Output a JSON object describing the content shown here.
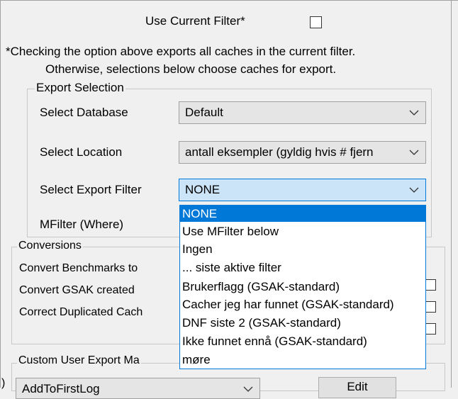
{
  "use_current_filter": {
    "label": "Use Current Filter*",
    "checked": false
  },
  "note": {
    "line1": "*Checking the option above exports all caches in the current filter.",
    "line2": "Otherwise, selections below choose caches for export."
  },
  "export_selection": {
    "legend": "Export Selection",
    "database_label": "Select Database",
    "database_value": "Default",
    "location_label": "Select Location",
    "location_value": "antall eksempler (gyldig hvis # fjern",
    "filter_label": "Select Export Filter",
    "filter_value": "NONE",
    "mfilter_label": "MFilter (Where)"
  },
  "filter_dropdown": {
    "options": [
      "NONE",
      "Use MFilter below",
      "Ingen",
      "... siste aktive filter",
      "Brukerflagg (GSAK-standard)",
      "Cacher jeg har funnet (GSAK-standard)",
      "DNF siste 2 (GSAK-standard)",
      "Ikke funnet ennå (GSAK-standard)",
      "møre"
    ],
    "selected_index": 0
  },
  "conversions": {
    "legend": "Conversions",
    "items": [
      "Convert Benchmarks to",
      "Convert GSAK created",
      "Correct Duplicated Cach"
    ]
  },
  "custom_macro": {
    "legend": "Custom User Export Ma",
    "combo_value": "AddToFirstLog",
    "edit_label": "Edit",
    "left_fragment": ")"
  }
}
